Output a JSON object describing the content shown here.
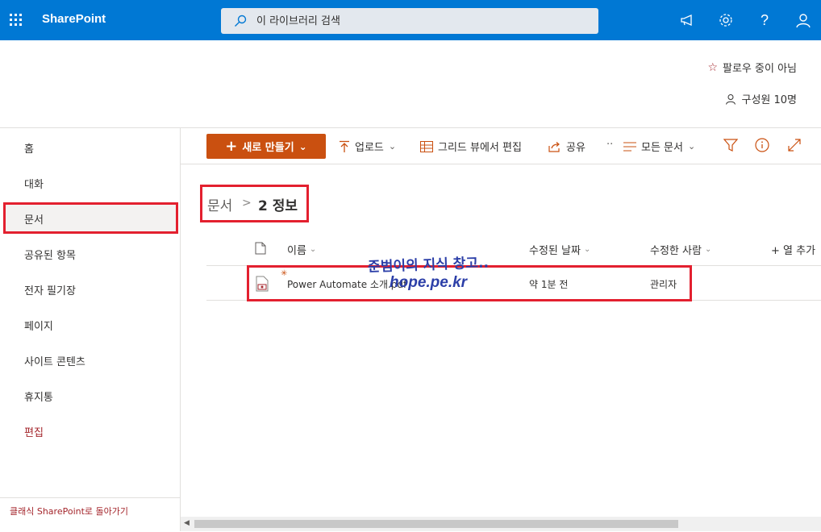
{
  "suite": {
    "app_name": "SharePoint",
    "search_placeholder": "이 라이브러리 검색",
    "icons": [
      "waffle-icon",
      "megaphone-icon",
      "gear-icon",
      "help-icon",
      "person-icon"
    ],
    "accent": "#0078d4"
  },
  "site": {
    "follow_label": "팔로우 중이 아님",
    "members_label": "구성원 10명"
  },
  "nav": {
    "items": [
      {
        "label": "홈"
      },
      {
        "label": "대화"
      },
      {
        "label": "문서"
      },
      {
        "label": "공유된 항목"
      },
      {
        "label": "전자 필기장"
      },
      {
        "label": "페이지"
      },
      {
        "label": "사이트 콘텐츠"
      },
      {
        "label": "휴지통"
      },
      {
        "label": "편집"
      }
    ],
    "selected": "문서",
    "classic_link": "클래식 SharePoint로 돌아가기"
  },
  "commands": {
    "new": "새로 만들기",
    "upload": "업로드",
    "grid_edit": "그리드 뷰에서 편집",
    "share": "공유",
    "more": "··",
    "view": "모든 문서",
    "new_color": "#ca5010"
  },
  "breadcrumb": {
    "root": "문서",
    "separator": ">",
    "current": "2 정보"
  },
  "list": {
    "columns": [
      "이름",
      "수정된 날짜",
      "수정한 사람",
      "+ 열 추가"
    ],
    "rows": [
      {
        "name": "Power Automate 소개.pdf",
        "modified": "약 1분 전",
        "modified_by": "관리자"
      }
    ]
  },
  "watermark": {
    "line1": "준범이의 지식 창고..",
    "line2": "hope.pe.kr"
  },
  "highlight_color": "#e3202f"
}
